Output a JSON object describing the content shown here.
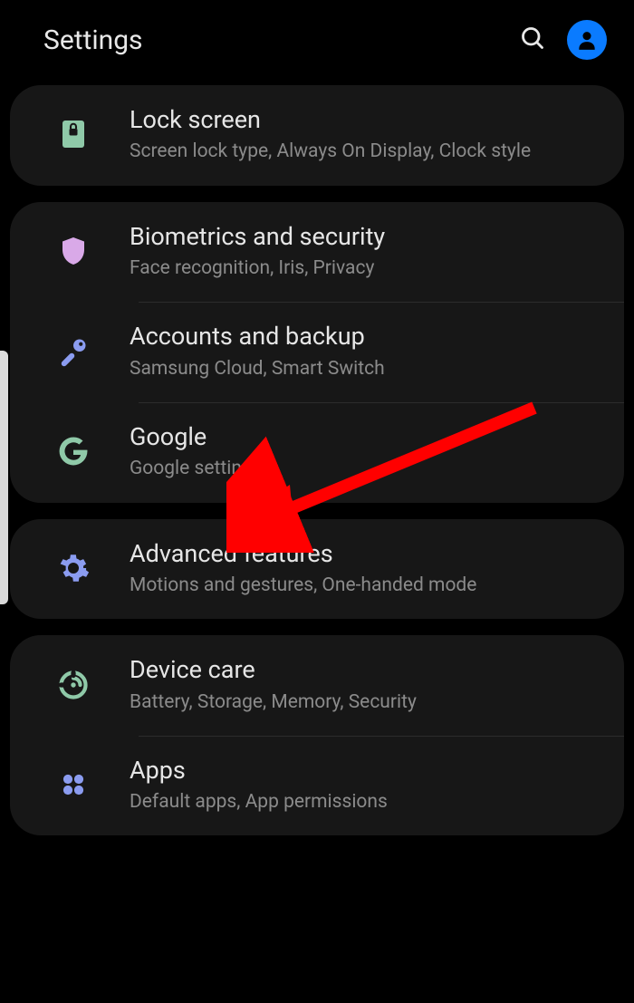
{
  "header": {
    "title": "Settings"
  },
  "groups": [
    {
      "items": [
        {
          "icon": "lock-icon",
          "title": "Lock screen",
          "subtitle": "Screen lock type, Always On Display, Clock style"
        }
      ]
    },
    {
      "items": [
        {
          "icon": "shield-icon",
          "title": "Biometrics and security",
          "subtitle": "Face recognition, Iris, Privacy"
        },
        {
          "icon": "key-icon",
          "title": "Accounts and backup",
          "subtitle": "Samsung Cloud, Smart Switch"
        },
        {
          "icon": "google-icon",
          "title": "Google",
          "subtitle": "Google settings"
        }
      ]
    },
    {
      "items": [
        {
          "icon": "gear-plus-icon",
          "title": "Advanced features",
          "subtitle": "Motions and gestures, One-handed mode"
        }
      ]
    },
    {
      "items": [
        {
          "icon": "device-care-icon",
          "title": "Device care",
          "subtitle": "Battery, Storage, Memory, Security"
        },
        {
          "icon": "apps-icon",
          "title": "Apps",
          "subtitle": "Default apps, App permissions"
        }
      ]
    }
  ],
  "annotation": {
    "arrow_target": "google-item"
  }
}
